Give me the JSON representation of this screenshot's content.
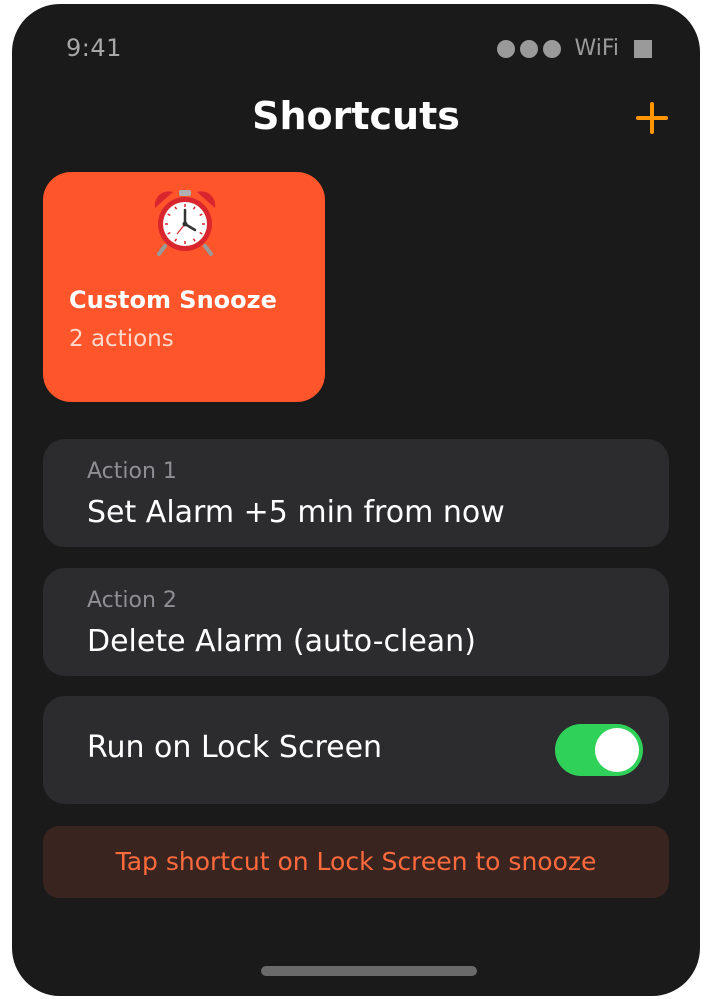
{
  "status_bar": {
    "time": "9:41",
    "wifi": "WiFi",
    "signal_icon": "signal-dots-icon",
    "battery_icon": "battery-icon"
  },
  "nav": {
    "title": "Shortcuts",
    "add_icon": "plus-icon"
  },
  "shortcut": {
    "icon": "alarm-clock-icon",
    "title": "Custom Snooze",
    "subtitle": "2 actions",
    "color": "#ff552b"
  },
  "actions": [
    {
      "label": "Action 1",
      "value": "Set Alarm +5 min from now"
    },
    {
      "label": "Action 2",
      "value": "Delete Alarm (auto-clean)"
    }
  ],
  "lock_screen": {
    "label": "Run on Lock Screen",
    "enabled": true,
    "toggle_color": "#30d158"
  },
  "hint": {
    "text": "Tap shortcut on Lock Screen to snooze",
    "color": "#ff6a3d"
  },
  "colors": {
    "accent": "#ff9500",
    "background": "#1a1a1a",
    "card": "#2c2c2e"
  }
}
